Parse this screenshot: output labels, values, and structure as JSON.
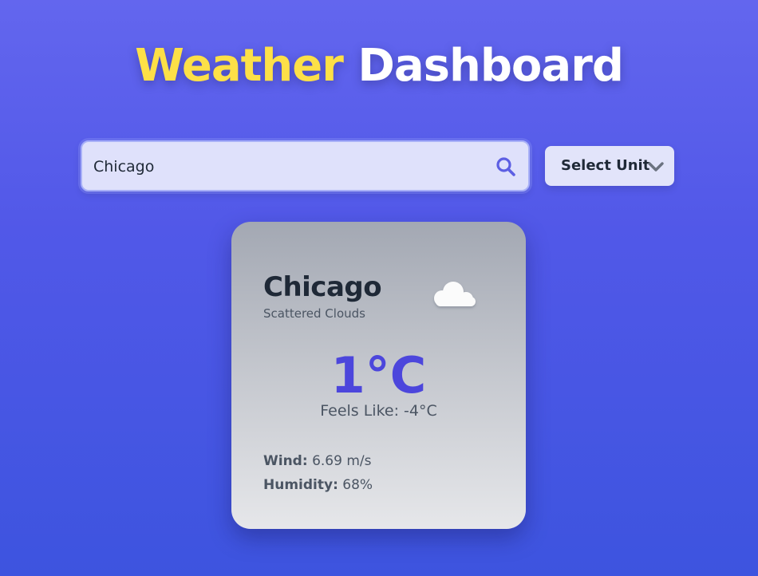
{
  "header": {
    "title_accent": "Weather",
    "title_rest": "Dashboard"
  },
  "search": {
    "value": "Chicago",
    "icon": "search-icon"
  },
  "unit_select": {
    "label": "Select Unit",
    "icon": "chevron-down-icon"
  },
  "weather": {
    "city": "Chicago",
    "description": "Scattered Clouds",
    "icon": "cloud-icon",
    "temperature": "1°C",
    "feels_like": "Feels Like: -4°C",
    "wind_label": "Wind:",
    "wind_value": "6.69 m/s",
    "humidity_label": "Humidity:",
    "humidity_value": "68%"
  },
  "colors": {
    "accent": "#fde047",
    "temperature": "#4c46dc",
    "background_top": "#6366ee",
    "background_bottom": "#3d54df"
  }
}
